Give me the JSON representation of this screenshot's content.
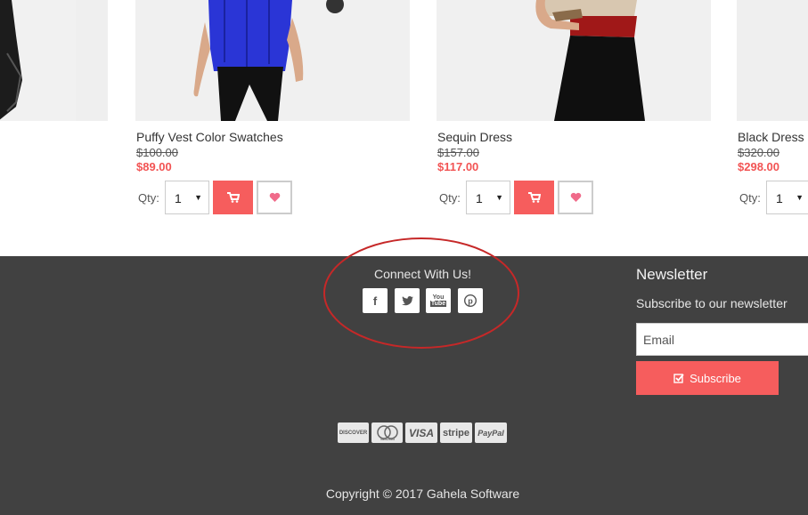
{
  "products": [
    {
      "name": "Puffy Vest Color Swatches",
      "old_price": "$100.00",
      "new_price": "$89.00"
    },
    {
      "name": "Sequin Dress",
      "old_price": "$157.00",
      "new_price": "$117.00"
    },
    {
      "name": "Black Dress",
      "old_price": "$320.00",
      "new_price": "$298.00"
    }
  ],
  "qty": {
    "label": "Qty:",
    "value": "1"
  },
  "colors": {
    "accent": "#f65d5d",
    "price": "#f25454",
    "footer_bg": "#414141",
    "highlight": "#c62828"
  },
  "icons": {
    "cart": "cart-icon",
    "wishlist": "heart-icon"
  },
  "footer": {
    "connect_title": "Connect With Us!",
    "social": [
      {
        "name": "facebook",
        "glyph": "f"
      },
      {
        "name": "twitter",
        "glyph": "t"
      },
      {
        "name": "youtube",
        "glyph": "You\nTube"
      },
      {
        "name": "pinterest",
        "glyph": "P"
      }
    ],
    "newsletter": {
      "title": "Newsletter",
      "subtitle": "Subscribe to our newsletter",
      "email_placeholder": "Email",
      "subscribe_label": "Subscribe"
    },
    "payments": [
      "DISCOVER",
      "mastercard",
      "VISA",
      "stripe",
      "PayPal"
    ],
    "copyright": "Copyright © 2017 Gahela Software"
  }
}
